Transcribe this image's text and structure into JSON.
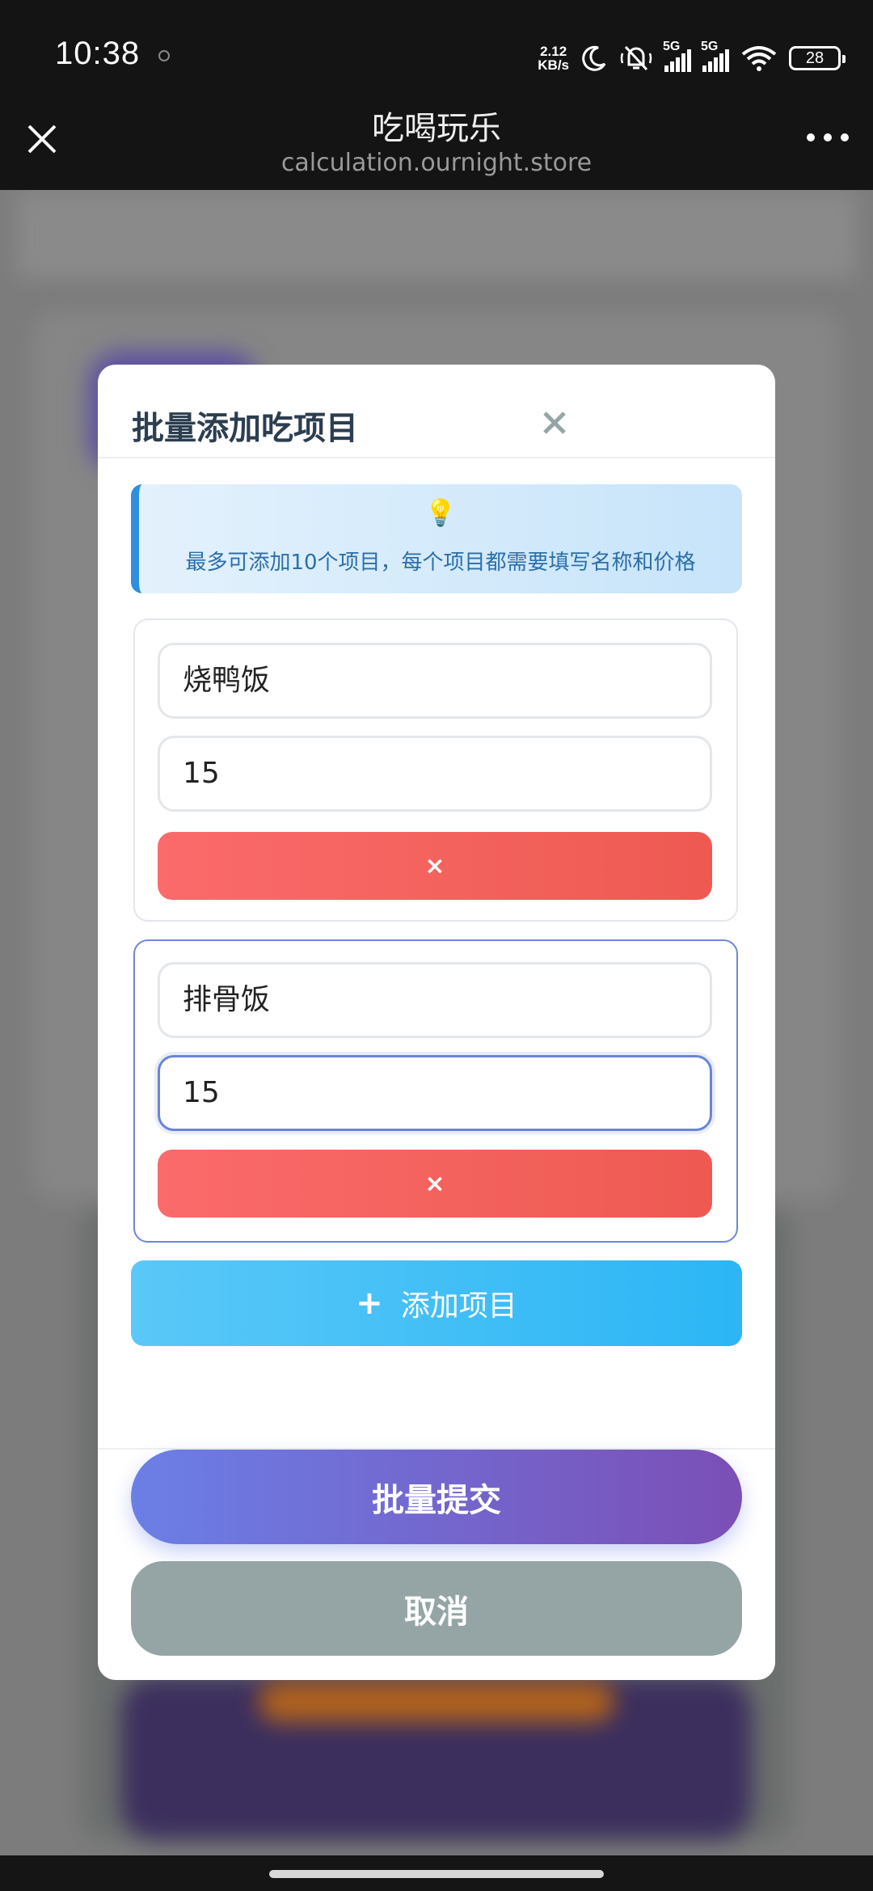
{
  "status_bar": {
    "time": "10:38",
    "net_speed_value": "2.12",
    "net_speed_unit": "KB/s",
    "signal_1_label": "5G",
    "signal_2_label": "5G",
    "battery": "28",
    "icons": [
      "dnd-moon-icon",
      "mute-bell-icon",
      "signal-icon",
      "wifi-icon",
      "battery-icon"
    ]
  },
  "browser": {
    "title": "吃喝玩乐",
    "url": "calculation.ournight.store",
    "close_icon": "close-icon",
    "more_icon": "more-dots-icon"
  },
  "modal": {
    "title": "批量添加吃项目",
    "close_icon": "close-icon",
    "tip": {
      "icon": "💡",
      "text": "最多可添加10个项目，每个项目都需要填写名称和价格"
    },
    "items": [
      {
        "name": "烧鸭饭",
        "price": "15",
        "delete_label": "×"
      },
      {
        "name": "排骨饭",
        "price": "15",
        "delete_label": "×"
      }
    ],
    "add_item": {
      "icon": "+",
      "label": "添加项目"
    },
    "submit_label": "批量提交",
    "cancel_label": "取消"
  },
  "colors": {
    "title_text": "#2c3e50",
    "tip_border": "#2c8fe0",
    "delete_button": "#f25f5c",
    "add_button": "#3bbdf6",
    "submit_start": "#6b7fe6",
    "submit_end": "#7b4fb6",
    "cancel_button": "#95a5a6"
  }
}
